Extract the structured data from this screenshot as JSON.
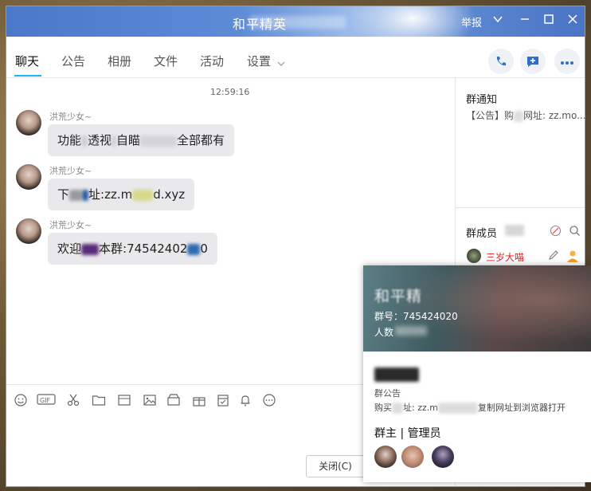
{
  "window": {
    "title": "和平精英",
    "report_label": "举报"
  },
  "tabs": [
    {
      "label": "聊天"
    },
    {
      "label": "公告"
    },
    {
      "label": "相册"
    },
    {
      "label": "文件"
    },
    {
      "label": "活动"
    },
    {
      "label": "设置"
    }
  ],
  "chat": {
    "time": "12:59:16",
    "messages": [
      {
        "sender": "洪荒少女~",
        "text_a": "功能",
        "text_b": "透视",
        "text_c": "自瞄",
        "text_d": "全部都有"
      },
      {
        "sender": "洪荒少女~",
        "text_a": "下",
        "text_b": "址:zz.m",
        "text_c": "d.xyz"
      },
      {
        "sender": "洪荒少女~",
        "text_a": "欢迎",
        "text_b": "本群:74542402",
        "text_c": "0"
      }
    ]
  },
  "input": {
    "close_label": "关闭(C)"
  },
  "right": {
    "notice_title": "群通知",
    "notice_text_a": "【公告】购",
    "notice_text_b": "网址: zz.mo...",
    "members_title": "群成员",
    "member_name": "三岁大喵"
  },
  "popup": {
    "title": "和平精",
    "group_number": "群号：745424020",
    "count_label": "人数",
    "announcement_label": "群公告",
    "announcement_text_a": "购买",
    "announcement_text_b": "址: zz.m",
    "announcement_text_c": "复制网址到浏览器打开",
    "owner_label": "群主 | 管理员"
  },
  "icons": {
    "phone": "phone-icon",
    "add_chat": "add-chat-icon",
    "more": "more-icon"
  }
}
